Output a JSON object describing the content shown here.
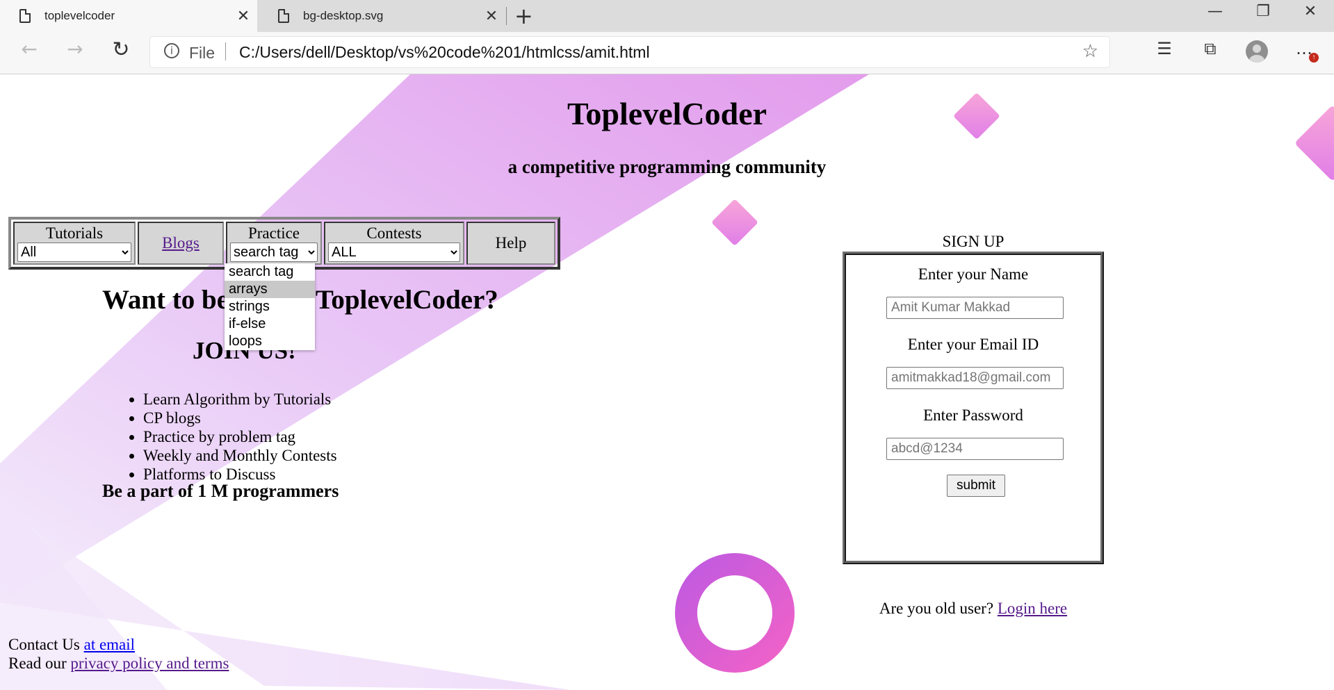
{
  "browser": {
    "tabs": [
      {
        "title": "toplevelcoder",
        "active": true
      },
      {
        "title": "bg-desktop.svg",
        "active": false
      }
    ],
    "address_prefix": "File",
    "url": "C:/Users/dell/Desktop/vs%20code%201/htmlcss/amit.html",
    "notification_badge": "↑",
    "icons": [
      "back-icon",
      "forward-icon",
      "reload-icon",
      "info-icon",
      "star-icon",
      "favorites-icon",
      "collections-icon",
      "profile-icon",
      "more-icon",
      "minimize-icon",
      "restore-icon",
      "close-icon"
    ]
  },
  "header": {
    "title": "ToplevelCoder",
    "subtitle": "a competitive programming community"
  },
  "navbar": {
    "tutorials": {
      "label": "Tutorials",
      "selected": "All"
    },
    "blogs": {
      "label": "Blogs"
    },
    "practice": {
      "label": "Practice",
      "selected": "search tag",
      "options": [
        "search tag",
        "arrays",
        "strings",
        "if-else",
        "loops"
      ],
      "highlighted": "arrays"
    },
    "contests": {
      "label": "Contests",
      "selected": "ALL"
    },
    "help": {
      "label": "Help"
    }
  },
  "main": {
    "hero": "Want to become a ToplevelCoder?",
    "join": "JOIN US!",
    "features": [
      "Learn Algorithm by Tutorials",
      "CP blogs",
      "Practice by problem tag",
      "Weekly and Monthly Contests",
      "Platforms to Discuss"
    ],
    "tagline": "Be a part of 1 M programmers"
  },
  "footer": {
    "contact_text": "Contact Us ",
    "contact_link": "at email",
    "privacy_text": "Read our ",
    "privacy_link": "privacy policy and terms"
  },
  "signup": {
    "heading": "SIGN UP",
    "name_label": "Enter your Name",
    "name_placeholder": "Amit Kumar Makkad",
    "email_label": "Enter your Email ID",
    "email_placeholder": "amitmakkad18@gmail.com",
    "password_label": "Enter Password",
    "password_placeholder": "abcd@1234",
    "submit": "submit",
    "old_user_text": "Are you old user? ",
    "login_link": "Login here"
  },
  "colors": {
    "accent_pink": "#f07ecf",
    "accent_purple": "#c48cf0",
    "visited_link": "#551a8b",
    "link": "#0000ee"
  }
}
